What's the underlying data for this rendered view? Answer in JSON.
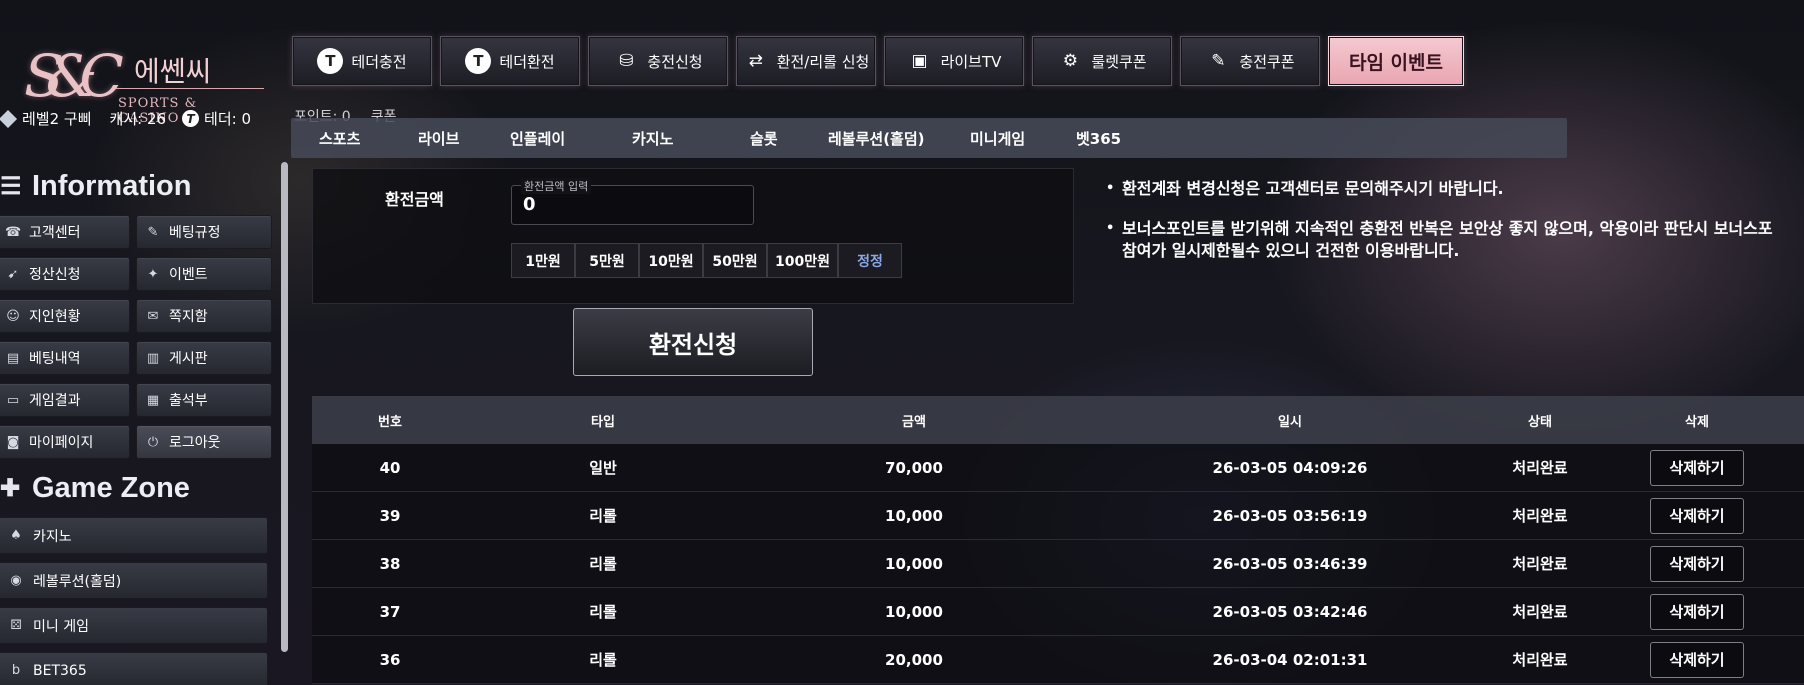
{
  "logo": {
    "mark": "S&C",
    "korean": "에쎈씨",
    "english": "SPORTS & CASINO"
  },
  "topnav": [
    {
      "label": "테더충전",
      "icon": "tether-charge-icon"
    },
    {
      "label": "테더환전",
      "icon": "tether-exchange-icon"
    },
    {
      "label": "충전신청",
      "icon": "coins-icon"
    },
    {
      "label": "환전/리롤 신청",
      "icon": "exchange-icon"
    },
    {
      "label": "라이브TV",
      "icon": "live-tv-icon"
    },
    {
      "label": "룰렛쿠폰",
      "icon": "roulette-icon"
    },
    {
      "label": "충전쿠폰",
      "icon": "ticket-icon"
    },
    {
      "label": "타임 이벤트"
    }
  ],
  "user": {
    "level": "레벨2 구삐",
    "cash": "캐시: 26",
    "tether": "테더: 0"
  },
  "pointbar": {
    "points": "포인트: 0",
    "coupon": "쿠폰"
  },
  "gametabs": [
    "스포츠",
    "라이브",
    "인플레이",
    "카지노",
    "슬롯",
    "레볼루션(홀덤)",
    "미니게임",
    "벳365"
  ],
  "sidebar": {
    "info_heading": "Information",
    "info_items": [
      {
        "label": "고객센터",
        "icon": "phone-icon"
      },
      {
        "label": "베팅규정",
        "icon": "rules-icon"
      },
      {
        "label": "정산신청",
        "icon": "settlement-icon"
      },
      {
        "label": "이벤트",
        "icon": "party-icon"
      },
      {
        "label": "지인현황",
        "icon": "people-icon"
      },
      {
        "label": "쪽지함",
        "icon": "message-icon"
      },
      {
        "label": "베팅내역",
        "icon": "history-icon"
      },
      {
        "label": "게시판",
        "icon": "board-icon"
      },
      {
        "label": "게임결과",
        "icon": "monitor-icon"
      },
      {
        "label": "출석부",
        "icon": "calendar-icon"
      },
      {
        "label": "마이페이지",
        "icon": "user-icon"
      },
      {
        "label": "로그아웃",
        "icon": "power-icon"
      }
    ],
    "game_heading": "Game Zone",
    "game_items": [
      {
        "label": "카지노",
        "icon": "spade-icon"
      },
      {
        "label": "레볼루션(홀덤)",
        "icon": "chips-icon"
      },
      {
        "label": "미니 게임",
        "icon": "dice-icon"
      },
      {
        "label": "BET365",
        "icon": "bet365-icon"
      }
    ]
  },
  "form": {
    "label": "환전금액",
    "input_legend": "환전금액 입력",
    "input_value": "0",
    "amounts": [
      "1만원",
      "5만원",
      "10만원",
      "50만원",
      "100만원"
    ],
    "reset": "정정",
    "submit": "환전신청"
  },
  "notices": [
    "환전계좌 변경신청은 고객센터로 문의해주시기 바랍니다.",
    "보너스포인트를 받기위해 지속적인 충환전 반복은 보안상 좋지 않으며, 악용이라 판단시 보너스포",
    "참여가 일시제한될수 있으니 건전한 이용바랍니다."
  ],
  "table": {
    "headers": [
      "번호",
      "타입",
      "금액",
      "일시",
      "상태",
      "삭제"
    ],
    "delete_label": "삭제하기",
    "rows": [
      [
        "40",
        "일반",
        "70,000",
        "26-03-05 04:09:26",
        "처리완료"
      ],
      [
        "39",
        "리롤",
        "10,000",
        "26-03-05 03:56:19",
        "처리완료"
      ],
      [
        "38",
        "리롤",
        "10,000",
        "26-03-05 03:46:39",
        "처리완료"
      ],
      [
        "37",
        "리롤",
        "10,000",
        "26-03-05 03:42:46",
        "처리완료"
      ],
      [
        "36",
        "리롤",
        "20,000",
        "26-03-04 02:01:31",
        "처리완료"
      ]
    ]
  }
}
